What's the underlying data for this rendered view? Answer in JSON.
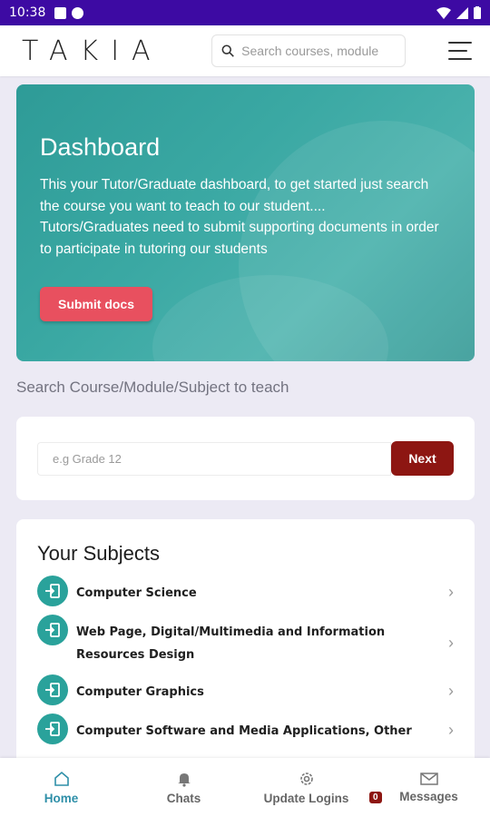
{
  "status_bar": {
    "time": "10:38"
  },
  "app": {
    "logo_text": "TAKIA",
    "search_placeholder": "Search courses, module"
  },
  "hero": {
    "title": "Dashboard",
    "text_line1": "This your Tutor/Graduate dashboard, to get started just search the course you want to teach to our student....",
    "text_line2": "Tutors/Graduates need to submit supporting documents in order to participate in tutoring our students",
    "submit_label": "Submit docs"
  },
  "search_section": {
    "label": "Search Course/Module/Subject to teach",
    "placeholder": "e.g Grade 12",
    "next_label": "Next"
  },
  "subjects": {
    "title": "Your Subjects",
    "items": [
      {
        "label": "Computer Science"
      },
      {
        "label": "Web Page, Digital/Multimedia and Information Resources Design"
      },
      {
        "label": "Computer Graphics"
      },
      {
        "label": "Computer Software and Media Applications, Other"
      }
    ]
  },
  "bottom_nav": {
    "items": [
      {
        "label": "Home",
        "icon": "home-icon"
      },
      {
        "label": "Chats",
        "icon": "bell-icon"
      },
      {
        "label": "Update Logins",
        "icon": "gear-icon"
      },
      {
        "label": "Messages",
        "icon": "mail-icon",
        "badge": "0"
      }
    ]
  },
  "colors": {
    "status_bar": "#3d0aa3",
    "hero": "#3aa8a3",
    "accent_red": "#e8505f",
    "next_button": "#8d1612",
    "icon_teal": "#2aa29b",
    "nav_active": "#2e8fa8"
  }
}
